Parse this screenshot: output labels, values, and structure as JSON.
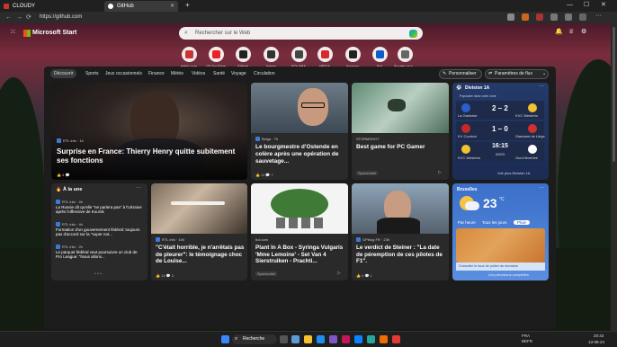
{
  "browser": {
    "tabs": [
      {
        "label": "CLOUDY"
      },
      {
        "label": "GitHub"
      }
    ],
    "url": "https://github.com"
  },
  "header": {
    "brand": "Microsoft Start",
    "search_placeholder": "Rechercher sur le Web"
  },
  "quick_links": [
    {
      "label": "eblkir.com",
      "color": "#c33"
    },
    {
      "label": "(3) YouTube",
      "color": "#e22"
    },
    {
      "label": "GitHub",
      "color": "#222"
    },
    {
      "label": "Anime",
      "color": "#333"
    },
    {
      "label": "SOLARA",
      "color": "#444"
    },
    {
      "label": "MEGA",
      "color": "#d9272e"
    },
    {
      "label": "Amazon",
      "color": "#222"
    },
    {
      "label": "Bol",
      "color": "#0a5ec9"
    },
    {
      "label": "Ajouter un s...",
      "color": "#666"
    }
  ],
  "feed_tabs": [
    "Découvrir",
    "Sports",
    "Jeux occasionnels",
    "Finance",
    "Météo",
    "Vidéos",
    "Santé",
    "Voyage",
    "Circulation"
  ],
  "buttons": {
    "personalize": "Personnaliser",
    "feed_settings": "Paramètres de flux"
  },
  "cards": {
    "henry": {
      "source": "RTL info · 1h",
      "title": "Surprise en France: Thierry Henry quitte subitement ses fonctions",
      "likes": "4"
    },
    "ostende": {
      "source": "Belga · 7h",
      "title": "Le bourgmestre d'Ostende en colère après une opération de sauvetage...",
      "likes": "11",
      "comments": "7"
    },
    "stormshot": {
      "source": "STORMSHOT",
      "title": "Best game for PC Gamer",
      "sponsored": "Sponsorisé"
    },
    "horrible": {
      "source": "RTL info · 10h",
      "title": "\"C'était horrible, je n'arrêtais pas de pleurer\": le témoignage choc de Louise...",
      "likes": "14",
      "comments": "3"
    },
    "plant": {
      "source": "bol.com",
      "title": "Plant In A Box - Syringa Vulgaris 'Mme Lemoine' - Set Van 4 Sierstruiken - Prachti...",
      "sponsored": "Sponsorisé"
    },
    "steiner": {
      "source": "GPblog FR · 23h",
      "title": "Le verdict de Steiner : \"La date de péremption de ces pilotes de F1\".",
      "likes": "4",
      "comments": "1"
    }
  },
  "sports": {
    "title": "Division 1A",
    "subtitle": "Populaire dans votre zone",
    "matches": [
      {
        "home": "La Gantoise",
        "away": "KVC Westerlo",
        "score": "2 – 2"
      },
      {
        "home": "KV Courtrai",
        "away": "Standard de Liège",
        "score": "1 – 0"
      },
      {
        "home": "KVC Westerlo",
        "away": "Oud-Heverlee",
        "score": "16:15",
        "date": "09/03"
      }
    ],
    "link": "Voir plus Division 1A"
  },
  "top_stories": {
    "title": "À la une",
    "items": [
      {
        "source": "RTL info · 4h",
        "text": "La Russie dit qu'elle \"ne parlera pas\" à l'Ukraine après l'offensive de Koursk"
      },
      {
        "source": "RTL info · 4h",
        "text": "Formation d'un gouvernement fédéral: toujours pas d'accord sur la \"super not..."
      },
      {
        "source": "RTL info · 2h",
        "text": "Le parquet fédéral veut poursuivre un club de Pro League: \"Nous allons..."
      }
    ]
  },
  "weather": {
    "city": "Bruxelles",
    "temp": "23",
    "unit": "°C",
    "tabs": [
      "Par heure",
      "Tous les jours",
      "Pluie"
    ],
    "pollen": "Consulter le taux de pollen du domaine",
    "link": "Les prévisions complètes"
  },
  "taskbar": {
    "search": "Recherche",
    "time": "20:43",
    "date": "13-08-24",
    "lang": "FRA\nBEFR"
  }
}
